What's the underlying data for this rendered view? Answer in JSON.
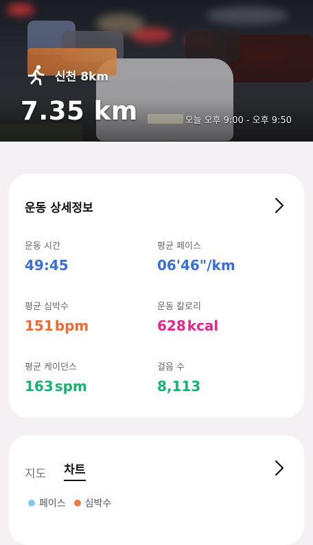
{
  "hero": {
    "route_name": "신천 8km",
    "distance": "7.35 km",
    "time_range": "오늘 오후 9:00 - 오후 9:50",
    "icon": "running-person-icon"
  },
  "details": {
    "title": "운동 상세정보",
    "metrics": [
      {
        "label": "운동 시간",
        "value": "49:45",
        "unit": "",
        "color": "#3a6fd8"
      },
      {
        "label": "평균 페이스",
        "value": "06'46\"/km",
        "unit": "",
        "color": "#3a6fd8"
      },
      {
        "label": "평균 심박수",
        "value": "151",
        "unit": "bpm",
        "color": "#ee6a33"
      },
      {
        "label": "운동 칼로리",
        "value": "628",
        "unit": "kcal",
        "color": "#e6258d"
      },
      {
        "label": "평균 케이던스",
        "value": "163",
        "unit": "spm",
        "color": "#19b371"
      },
      {
        "label": "걸음 수",
        "value": "8,113",
        "unit": "",
        "color": "#19b371"
      }
    ]
  },
  "chart_card": {
    "tabs": [
      "지도",
      "차트"
    ],
    "active_tab": "차트",
    "legend": [
      {
        "label": "페이스",
        "color": "#7fcbf0"
      },
      {
        "label": "심박수",
        "color": "#ee7a45"
      }
    ]
  }
}
